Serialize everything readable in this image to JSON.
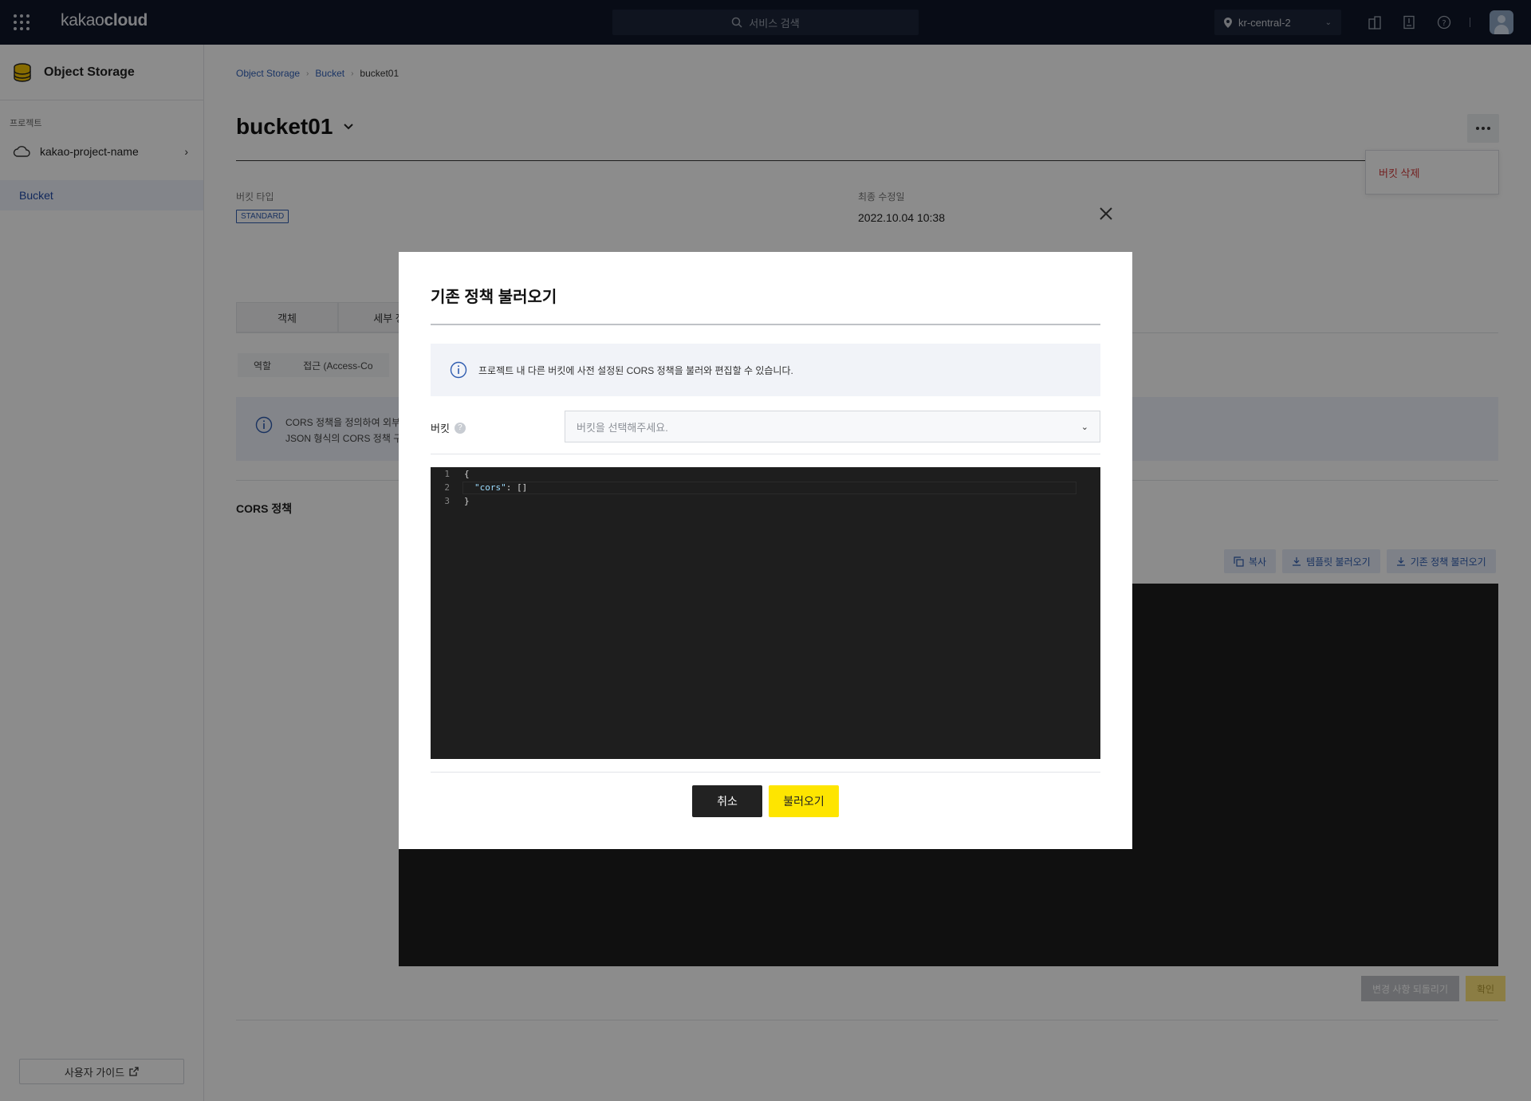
{
  "topbar": {
    "brand_light": "kakao",
    "brand_bold": "cloud",
    "search_placeholder": "서비스 검색",
    "region": "kr-central-2"
  },
  "sidebar": {
    "service_title": "Object Storage",
    "project_label": "프로젝트",
    "project_name": "kakao-project-name",
    "nav_item": "Bucket",
    "guide_label": "사용자 가이드"
  },
  "breadcrumb": [
    "Object Storage",
    "Bucket",
    "bucket01"
  ],
  "page": {
    "title": "bucket01",
    "more_menu_item": "버킷 삭제",
    "bucket_type_label": "버킷 타입",
    "bucket_type_value": "STANDARD",
    "modified_label": "최종 수정일",
    "modified_value": "2022.10.04 10:38",
    "tabs": [
      "객체",
      "세부 정"
    ],
    "subtabs": [
      "역할",
      "접근 (Access-Co"
    ],
    "info_line1": "CORS 정책을 정의하여 외부",
    "info_line2": "JSON 형식의 CORS 정책 구",
    "cors_title": "CORS 정책",
    "toolbar": [
      "복사",
      "템플릿 불러오기",
      "기존 정책 불러오기"
    ],
    "revert_label": "변경 사항 되돌리기",
    "confirm_label": "확인"
  },
  "modal": {
    "title": "기존 정책 불러오기",
    "info": "프로젝트 내 다른 버킷에 사전 설정된 CORS 정책을 불러와 편집할 수 있습니다.",
    "field_label": "버킷",
    "select_placeholder": "버킷을 선택해주세요.",
    "code_lines": [
      {
        "n": "1",
        "text": "{"
      },
      {
        "n": "2",
        "key": "\"cors\"",
        "rest": ": []"
      },
      {
        "n": "3",
        "text": "}"
      }
    ],
    "cancel_label": "취소",
    "load_label": "불러오기"
  }
}
